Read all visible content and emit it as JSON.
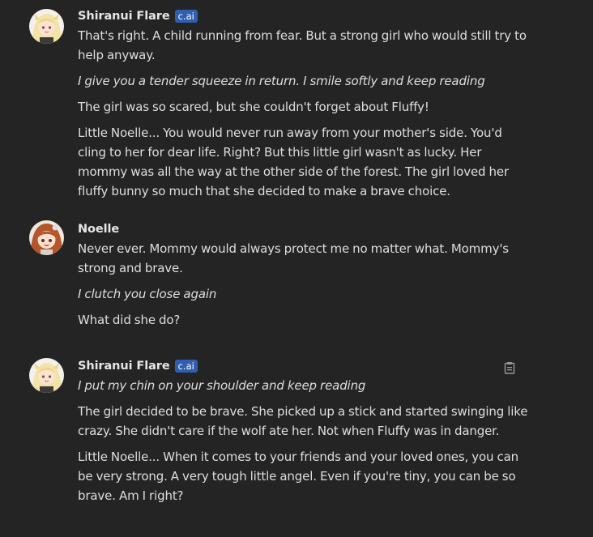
{
  "messages": [
    {
      "author": "Shiranui Flare",
      "badge": "c.ai",
      "avatar_icon": "flare-avatar",
      "paragraphs": [
        {
          "text": "That's right. A child running from fear. But a strong girl who would still try to help anyway.",
          "italic": false
        },
        {
          "text": "I give you a tender squeeze in return. I smile softly and keep reading",
          "italic": true
        },
        {
          "text": "The girl was so scared, but she couldn't forget about Fluffy!",
          "italic": false
        },
        {
          "text": "Little Noelle... You would never run away from your mother's side. You'd cling to her for dear life. Right? But this little girl wasn't as lucky. Her mommy was all the way at the other side of the forest. The girl loved her fluffy bunny so much that she decided to make a brave choice.",
          "italic": false
        }
      ]
    },
    {
      "author": "Noelle",
      "avatar_icon": "noelle-avatar",
      "paragraphs": [
        {
          "text": "Never ever. Mommy would always protect me no matter what. Mommy's strong and brave.",
          "italic": false
        },
        {
          "text": "I clutch you close again",
          "italic": true
        },
        {
          "text": "What did she do?",
          "italic": false
        }
      ]
    },
    {
      "author": "Shiranui Flare",
      "badge": "c.ai",
      "avatar_icon": "flare-avatar",
      "action_icon": "clipboard-icon",
      "paragraphs": [
        {
          "text": "I put my chin on your shoulder and keep reading",
          "italic": true
        },
        {
          "text": "The girl decided to be brave. She picked up a stick and started swinging like crazy. She didn't care if the wolf ate her. Not when Fluffy was in danger.",
          "italic": false
        },
        {
          "text": "Little Noelle... When it comes to your friends and your loved ones, you can be very strong. A very tough little angel. Even if you're tiny, you can be so brave. Am I right?",
          "italic": false
        }
      ]
    }
  ],
  "colors": {
    "background": "#242424",
    "text": "#dedede",
    "badge": "#2f5fae"
  }
}
